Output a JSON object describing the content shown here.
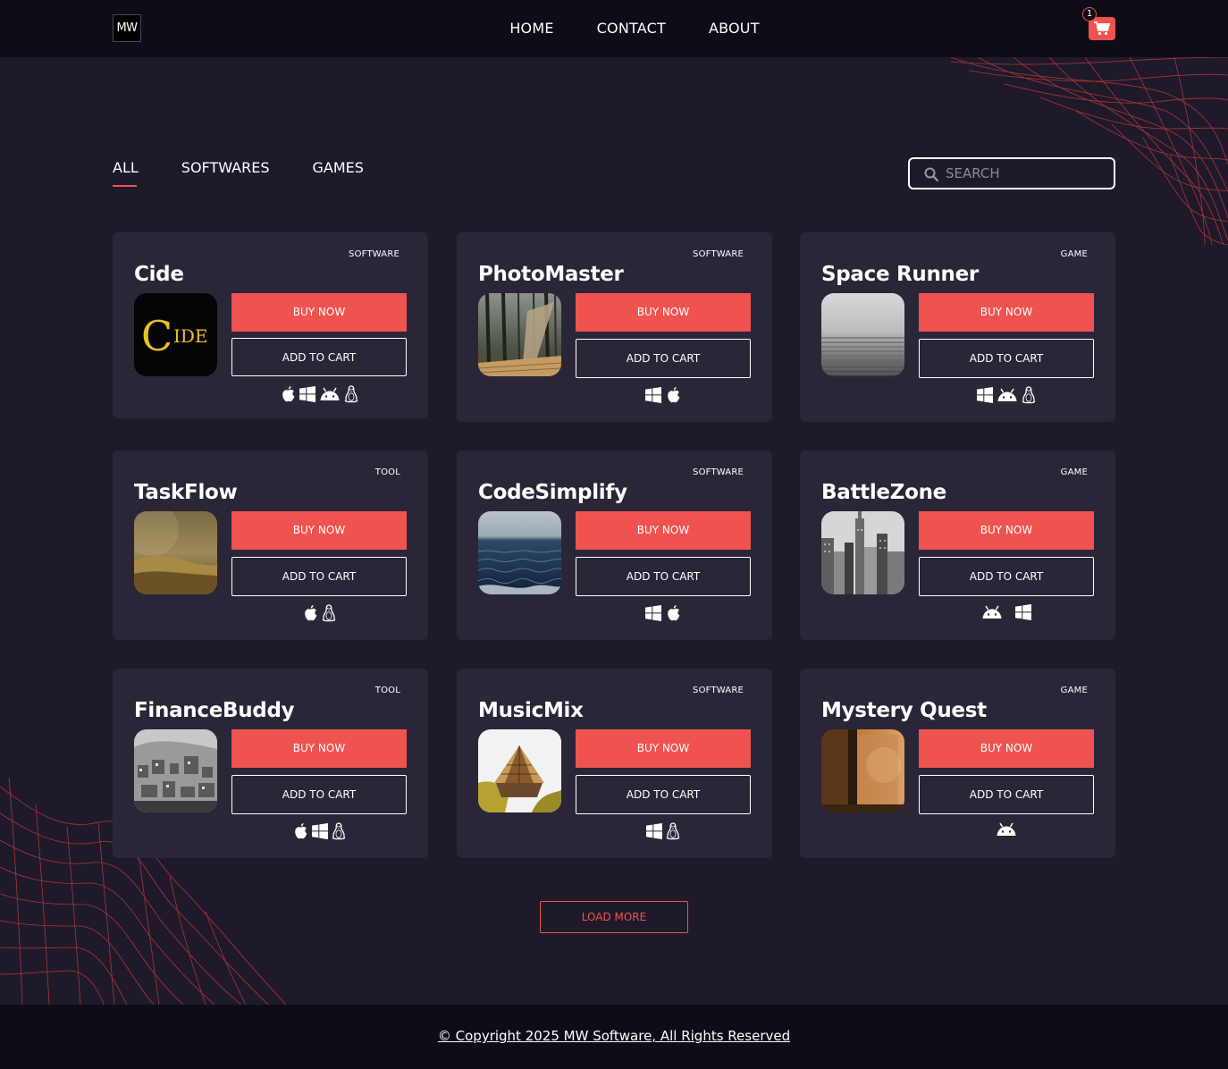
{
  "header": {
    "logo": "MW",
    "nav": [
      "HOME",
      "CONTACT",
      "ABOUT"
    ],
    "cart_count": "1"
  },
  "filters": {
    "tabs": [
      "ALL",
      "SOFTWARES",
      "GAMES"
    ],
    "active": "ALL"
  },
  "search": {
    "placeholder": "SEARCH"
  },
  "products": [
    {
      "name": "Cide",
      "category": "SOFTWARE",
      "buy": "BUY NOW",
      "add": "ADD TO CART",
      "platforms": [
        "apple",
        "windows",
        "android",
        "linux"
      ],
      "thumb": "cide-logo"
    },
    {
      "name": "PhotoMaster",
      "category": "SOFTWARE",
      "buy": "BUY NOW",
      "add": "ADD TO CART",
      "platforms": [
        "windows",
        "apple"
      ],
      "thumb": "forest"
    },
    {
      "name": "Space Runner",
      "category": "GAME",
      "buy": "BUY NOW",
      "add": "ADD TO CART",
      "platforms": [
        "windows",
        "android",
        "linux"
      ],
      "thumb": "fog-steps"
    },
    {
      "name": "TaskFlow",
      "category": "TOOL",
      "buy": "BUY NOW",
      "add": "ADD TO CART",
      "platforms": [
        "apple",
        "linux"
      ],
      "thumb": "field"
    },
    {
      "name": "CodeSimplify",
      "category": "SOFTWARE",
      "buy": "BUY NOW",
      "add": "ADD TO CART",
      "platforms": [
        "windows",
        "apple"
      ],
      "thumb": "sea"
    },
    {
      "name": "BattleZone",
      "category": "GAME",
      "buy": "BUY NOW",
      "add": "ADD TO CART",
      "platforms": [
        "android",
        "windows"
      ],
      "thumb": "city"
    },
    {
      "name": "FinanceBuddy",
      "category": "TOOL",
      "buy": "BUY NOW",
      "add": "ADD TO CART",
      "platforms": [
        "apple",
        "windows",
        "linux"
      ],
      "thumb": "town"
    },
    {
      "name": "MusicMix",
      "category": "SOFTWARE",
      "buy": "BUY NOW",
      "add": "ADD TO CART",
      "platforms": [
        "windows",
        "linux"
      ],
      "thumb": "tent"
    },
    {
      "name": "Mystery Quest",
      "category": "GAME",
      "buy": "BUY NOW",
      "add": "ADD TO CART",
      "platforms": [
        "android"
      ],
      "thumb": "door"
    }
  ],
  "load_more": "LOAD MORE",
  "footer": {
    "copyright": "© Copyright 2025 MW Software, All Rights Reserved"
  },
  "colors": {
    "accent": "#ef5350",
    "background": "#1e1a2a",
    "card": "#2a2638",
    "bar": "#0f0c18"
  }
}
